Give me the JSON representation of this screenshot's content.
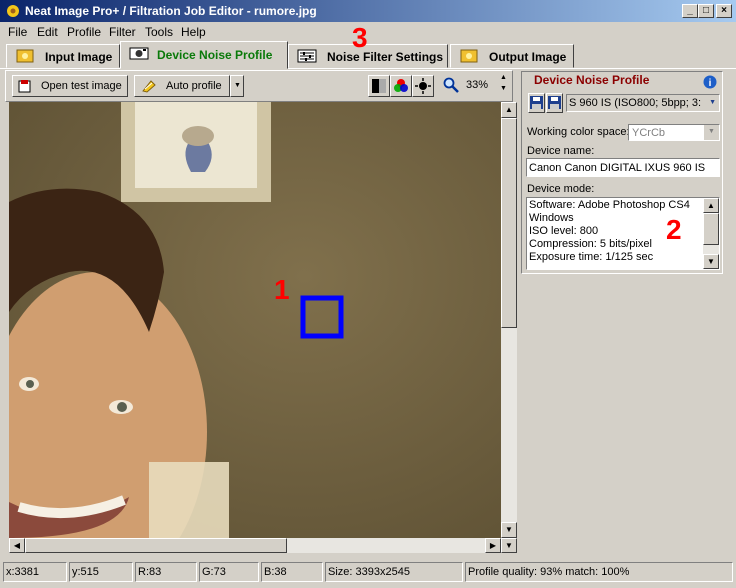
{
  "window": {
    "title": "Neat Image Pro+ / Filtration Job Editor - rumore.jpg"
  },
  "menu": [
    "File",
    "Edit",
    "Profile",
    "Filter",
    "Tools",
    "Help"
  ],
  "tabs": [
    {
      "label": "Input Image",
      "active": false
    },
    {
      "label": "Device Noise Profile",
      "active": true
    },
    {
      "label": "Noise Filter Settings",
      "active": false
    },
    {
      "label": "Output Image",
      "active": false
    }
  ],
  "toolbar": {
    "open_test_image": "Open test image",
    "auto_profile": "Auto profile",
    "zoom": "33%"
  },
  "panel": {
    "title": "Device Noise Profile",
    "profile_select": "S 960 IS (ISO800; 5bpp; 3:",
    "working_color_space_label": "Working color space:",
    "working_color_space": "YCrCb",
    "device_name_label": "Device name:",
    "device_name": "Canon Canon DIGITAL IXUS 960 IS",
    "device_mode_label": "Device mode:",
    "device_mode_lines": [
      "Software: Adobe Photoshop CS4",
      "Windows",
      "ISO level: 800",
      "Compression: 5 bits/pixel",
      "Exposure time: 1/125 sec"
    ]
  },
  "status": {
    "x": "x:3381",
    "y": "y:515",
    "r": "R:83",
    "g": "G:73",
    "b": "B:38",
    "size": "Size: 3393x2545",
    "quality": "Profile quality: 93%  match: 100%"
  },
  "annotations": {
    "a1": "1",
    "a2": "2",
    "a3": "3"
  },
  "colors": {
    "accent_active_tab": "#0a7a0a",
    "panel_title": "#8b0000",
    "annotation": "#ff0000",
    "selection_box": "#0000ff"
  }
}
